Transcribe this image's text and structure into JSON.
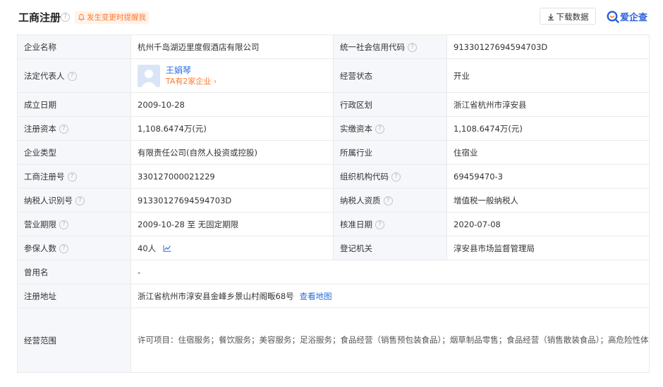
{
  "header": {
    "title": "工商注册",
    "notify_label": "发生变更时提醒我",
    "download_label": "下载数据",
    "logo_text": "爱企查"
  },
  "rows": {
    "company_name": {
      "label": "企业名称",
      "value": "杭州千岛湖迈里度假酒店有限公司"
    },
    "credit_code": {
      "label": "统一社会信用代码",
      "value": "91330127694594703D"
    },
    "legal_rep": {
      "label": "法定代表人",
      "name": "王娟琴",
      "sub": "TA有2家企业 ›"
    },
    "status": {
      "label": "经营状态",
      "value": "开业"
    },
    "founded": {
      "label": "成立日期",
      "value": "2009-10-28"
    },
    "district": {
      "label": "行政区划",
      "value": "浙江省杭州市淳安县"
    },
    "reg_capital": {
      "label": "注册资本",
      "value": "1,108.6474万(元)"
    },
    "paid_capital": {
      "label": "实缴资本",
      "value": "1,108.6474万(元)"
    },
    "company_type": {
      "label": "企业类型",
      "value": "有限责任公司(自然人投资或控股)"
    },
    "industry": {
      "label": "所属行业",
      "value": "住宿业"
    },
    "reg_number": {
      "label": "工商注册号",
      "value": "330127000021229"
    },
    "org_code": {
      "label": "组织机构代码",
      "value": "69459470-3"
    },
    "taxpayer_id": {
      "label": "纳税人识别号",
      "value": "91330127694594703D"
    },
    "taxpayer_qual": {
      "label": "纳税人资质",
      "value": "增值税一般纳税人"
    },
    "business_term": {
      "label": "营业期限",
      "value": "2009-10-28 至 无固定期限"
    },
    "approval_date": {
      "label": "核准日期",
      "value": "2020-07-08"
    },
    "insured": {
      "label": "参保人数",
      "value": "40人"
    },
    "authority": {
      "label": "登记机关",
      "value": "淳安县市场监督管理局"
    },
    "former_name": {
      "label": "曾用名",
      "value": "-"
    },
    "address": {
      "label": "注册地址",
      "value": "浙江省杭州市淳安县金峰乡景山村阁畈68号",
      "link": "查看地图"
    },
    "scope": {
      "label": "经营范围",
      "value": "许可项目：住宿服务；餐饮服务；美容服务；足浴服务；食品经营（销售预包装食品）；烟草制品零售；食品经营（销售散装食品）；高危险性体育运动（游泳）(依法须经批准的项目，经相关部门批准后方可开展经营活动，具体经营项目以审批结果为准)。一般项目：棋牌室服务；健身休闲活动；会议及展览服务；酒店管理；食用农产品零售；工艺美术品及收藏品零售（象牙及其制品除外）；实业投资(除依法须经批准的项目外，凭营业执照依法自主开展经营活动)。"
    }
  },
  "colors": {
    "label_bg": "#f5f7fa",
    "border": "#eaeaea",
    "link_blue": "#2b6de0",
    "accent_orange": "#ff7a2f",
    "logo_blue": "#2b5fd9"
  },
  "icons": [
    "help-icon",
    "bell-icon",
    "download-icon",
    "logo-icon",
    "avatar",
    "trend-chart-icon"
  ]
}
